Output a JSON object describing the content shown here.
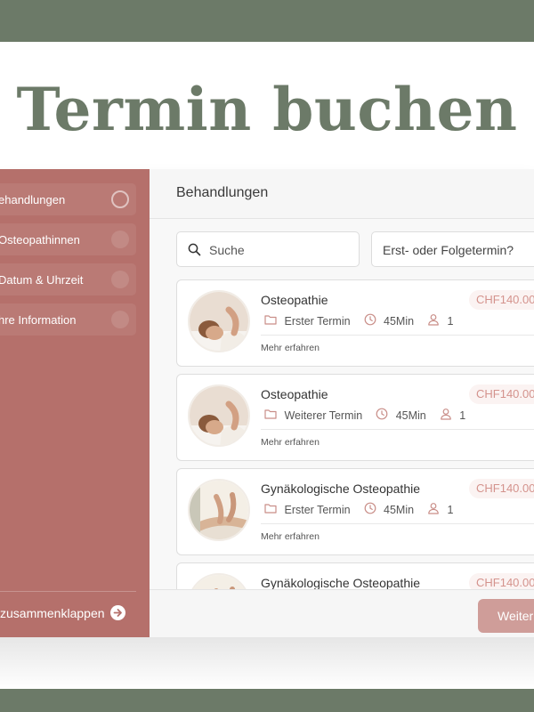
{
  "hero": {
    "title": "Termin buchen"
  },
  "sidebar": {
    "steps": [
      {
        "label": "ehandlungen",
        "active": true
      },
      {
        "label": "Osteopathinnen",
        "active": false
      },
      {
        "label": "Datum & Uhrzeit",
        "active": false
      },
      {
        "label": "hre Information",
        "active": false
      }
    ],
    "collapse_label": "zusammenklappen"
  },
  "main": {
    "title": "Behandlungen",
    "search_placeholder": "Suche",
    "select_placeholder": "Erst- oder Folgetermin?",
    "services": [
      {
        "name": "Osteopathie",
        "price": "CHF140.00",
        "type": "Erster Termin",
        "duration": "45Min",
        "persons": "1",
        "more": "Mehr erfahren"
      },
      {
        "name": "Osteopathie",
        "price": "CHF140.00",
        "type": "Weiterer Termin",
        "duration": "45Min",
        "persons": "1",
        "more": "Mehr erfahren"
      },
      {
        "name": "Gynäkologische Osteopathie",
        "price": "CHF140.00",
        "type": "Erster Termin",
        "duration": "45Min",
        "persons": "1",
        "more": "Mehr erfahren"
      },
      {
        "name": "Gynäkologische Osteopathie",
        "price": "CHF140.00"
      }
    ],
    "next_label": "Weiter"
  },
  "colors": {
    "sage": "#6c7a68",
    "sidebar": "#b5706b",
    "accent": "#cf9d99",
    "price": "#d4938d"
  },
  "icons": [
    "search-icon",
    "folder-icon",
    "clock-icon",
    "person-icon",
    "arrow-right-icon"
  ]
}
